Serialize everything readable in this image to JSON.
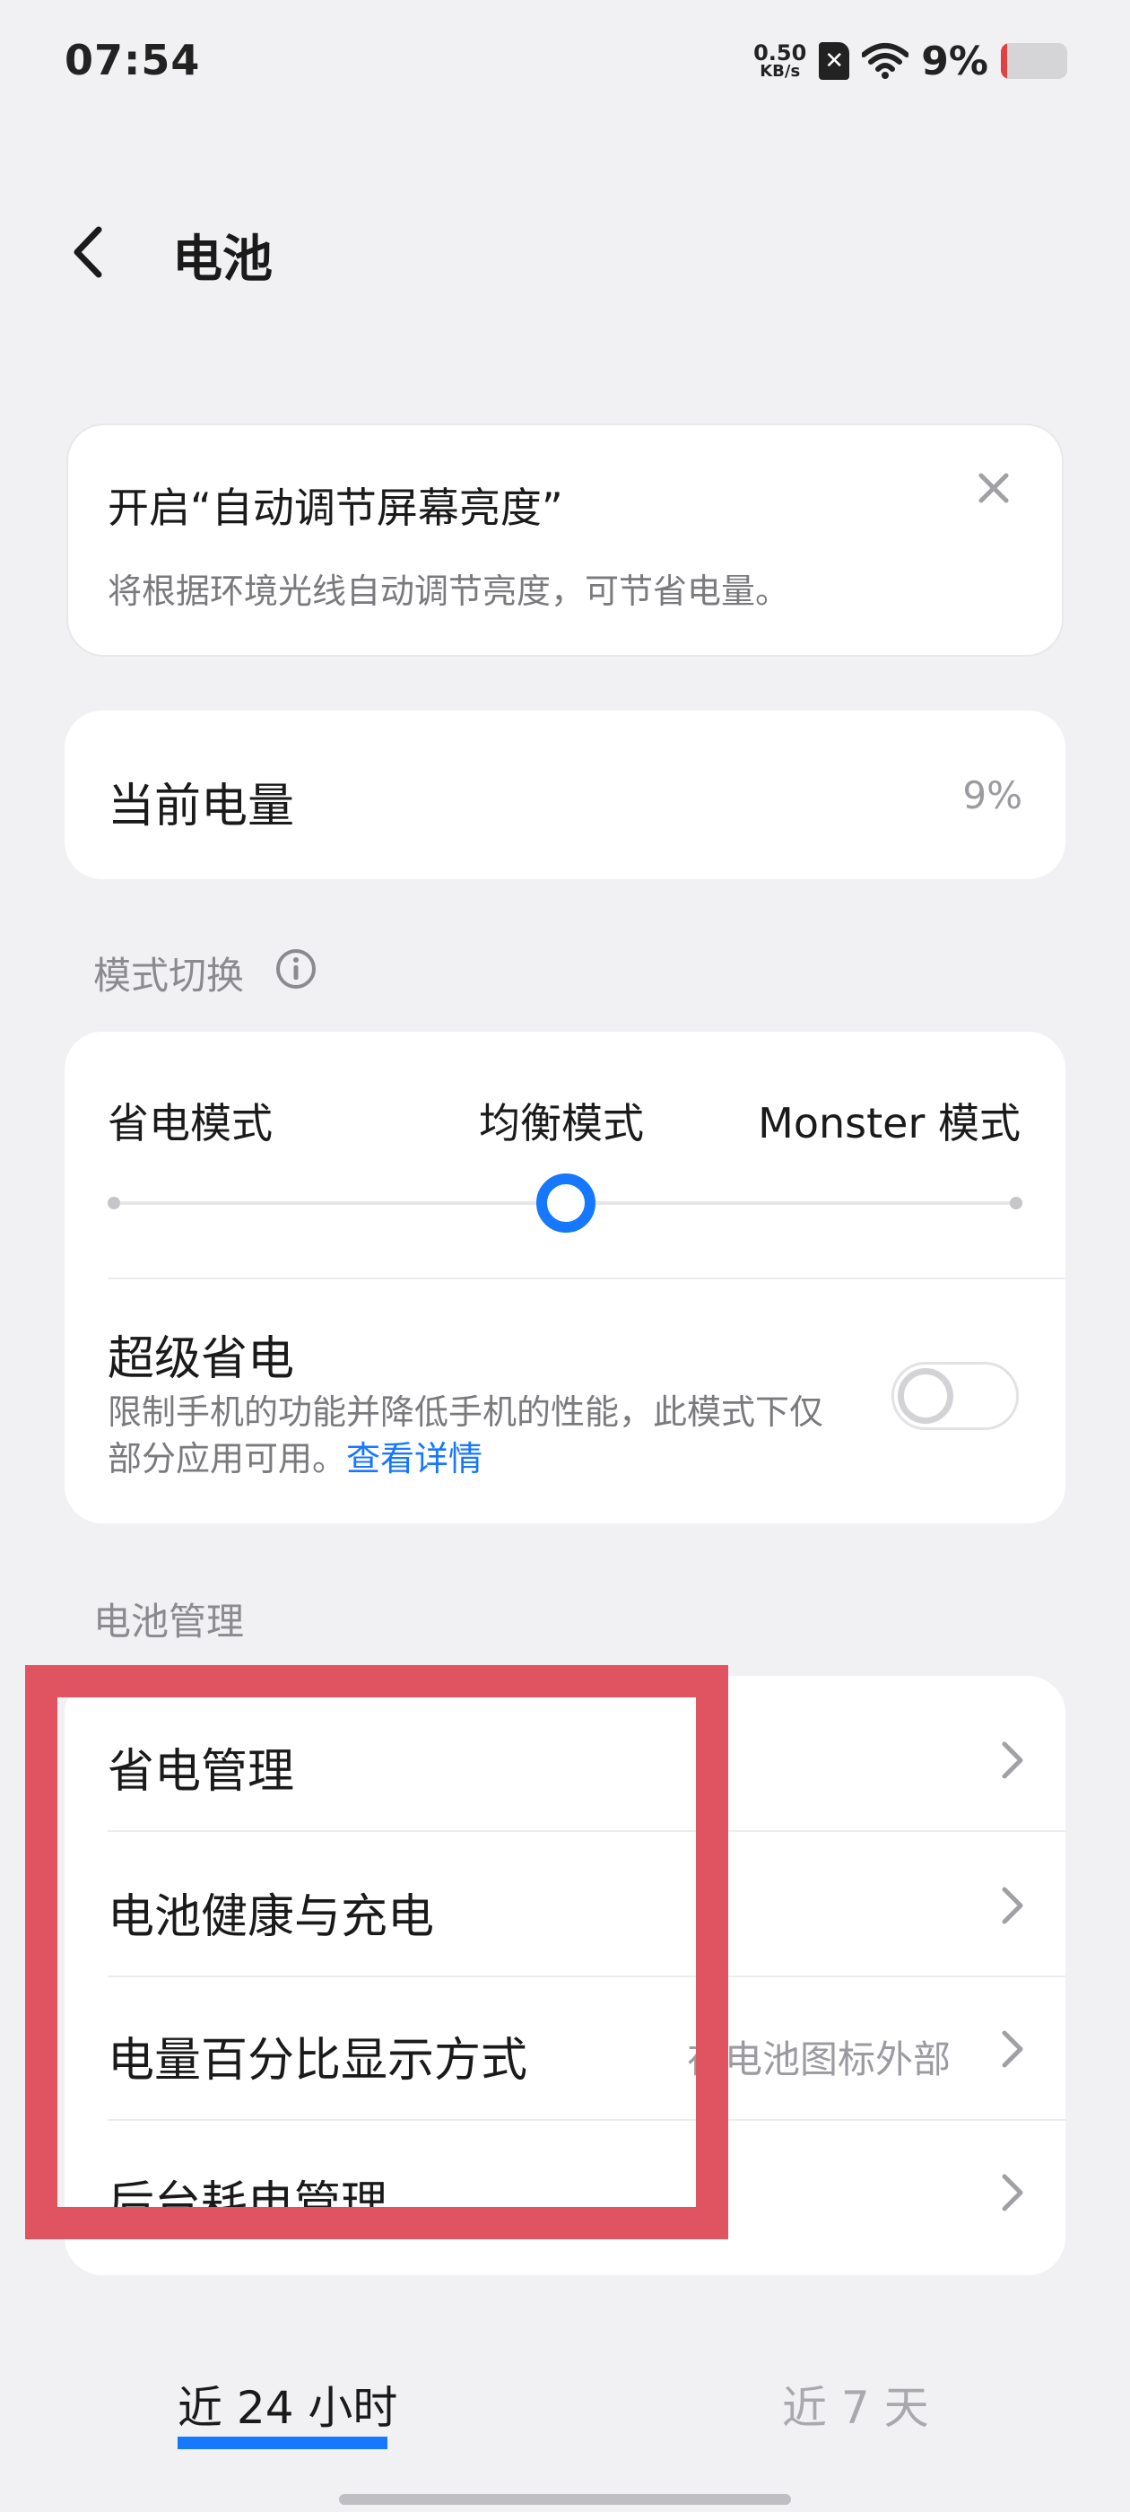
{
  "status_bar": {
    "time": "07:54",
    "net_speed_value": "0.50",
    "net_speed_unit": "KB/s",
    "sim_glyph": "✕",
    "battery_percent": "9%",
    "battery_level": 0.09,
    "battery_fill_color": "#e04040"
  },
  "header": {
    "title": "电池"
  },
  "notice": {
    "title": "开启“自动调节屏幕亮度”",
    "description": "将根据环境光线自动调节亮度，可节省电量。"
  },
  "battery_level": {
    "label": "当前电量",
    "value": "9%"
  },
  "mode_section": {
    "label": "模式切换",
    "options": [
      "省电模式",
      "均衡模式",
      "Monster 模式"
    ],
    "selected_index": 1,
    "super_saver": {
      "title": "超级省电",
      "description": "限制手机的功能并降低手机的性能，此模式下仅部分应用可用。",
      "link": "查看详情",
      "enabled": false
    }
  },
  "management": {
    "label": "电池管理",
    "items": [
      {
        "label": "省电管理",
        "value": ""
      },
      {
        "label": "电池健康与充电",
        "value": ""
      },
      {
        "label": "电量百分比显示方式",
        "value": "在电池图标外部"
      },
      {
        "label": "后台耗电管理",
        "value": ""
      }
    ]
  },
  "usage_tabs": [
    {
      "label": "近 24 小时",
      "active": true
    },
    {
      "label": "近 7 天",
      "active": false
    }
  ],
  "colors": {
    "accent": "#1677ff",
    "highlight": "#df5460",
    "background": "#f1f1f3"
  }
}
